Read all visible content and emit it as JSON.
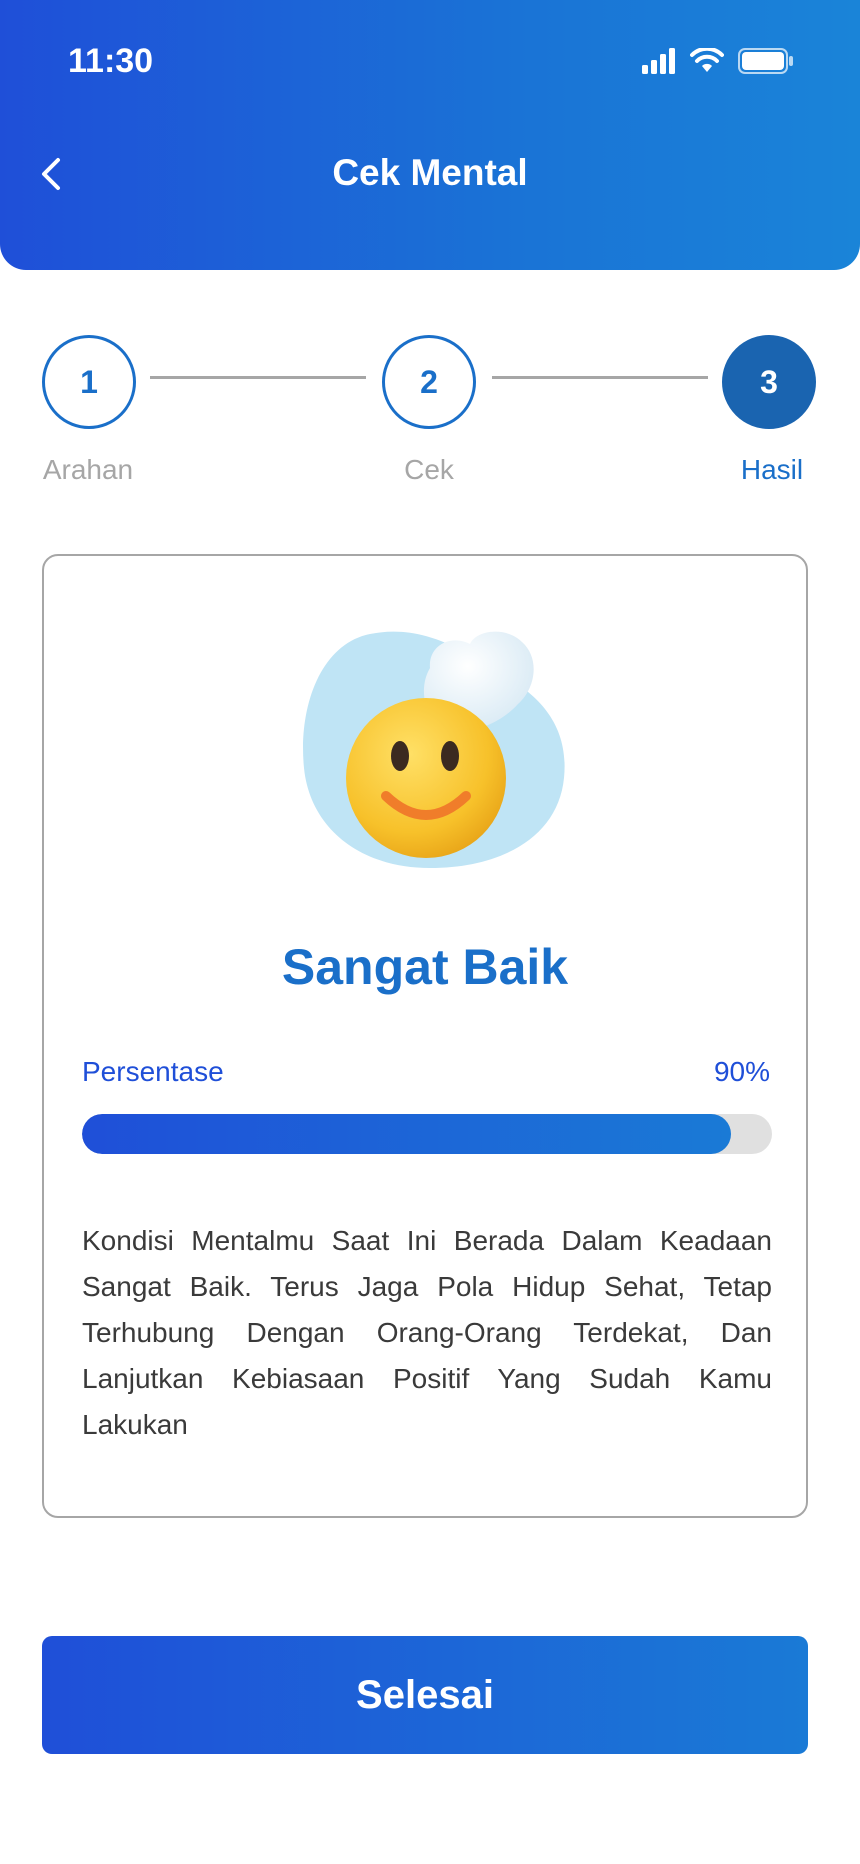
{
  "status_bar": {
    "time": "11:30",
    "icons": [
      "signal-icon",
      "wifi-icon",
      "battery-icon"
    ]
  },
  "header": {
    "title": "Cek Mental",
    "back_icon": "chevron-left-icon"
  },
  "stepper": {
    "steps": [
      {
        "number": "1",
        "label": "Arahan",
        "active": false
      },
      {
        "number": "2",
        "label": "Cek",
        "active": false
      },
      {
        "number": "3",
        "label": "Hasil",
        "active": true
      }
    ]
  },
  "result": {
    "illustration": "smiley-emoji-illustration",
    "title": "Sangat Baik",
    "percent_label": "Persentase",
    "percent_value": "90%",
    "progress": 0.94,
    "description": "Kondisi Mentalmu Saat Ini Berada Dalam Keadaan Sangat Baik. Terus Jaga Pola Hidup Sehat, Tetap Terhubung Dengan Orang-Orang Terdekat, Dan Lanjutkan Kebiasaan Positif Yang Sudah Kamu Lakukan"
  },
  "footer": {
    "finish_label": "Selesai"
  },
  "colors": {
    "primary": "#1f4fd8",
    "accent": "#1a6fc9",
    "muted": "#a6a6a6"
  }
}
